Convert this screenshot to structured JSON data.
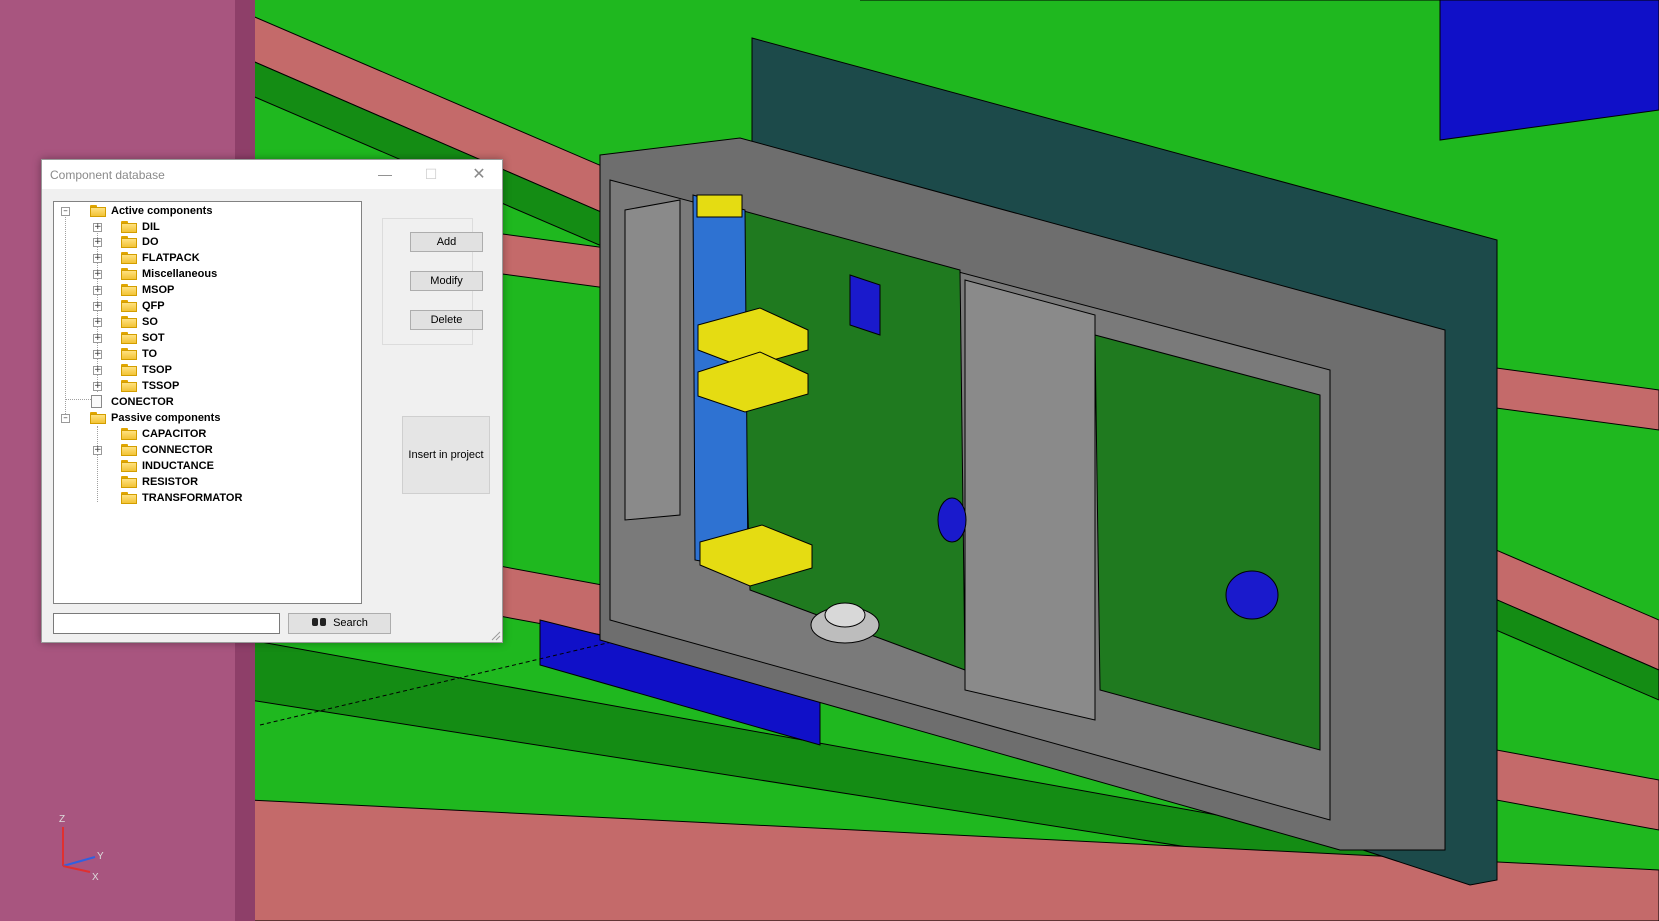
{
  "dialog": {
    "title": "Component database",
    "buttons": {
      "add": "Add",
      "modify": "Modify",
      "delete": "Delete",
      "insert": "Insert in project",
      "search": "Search"
    },
    "search_value": "",
    "tree": {
      "active": {
        "label": "Active components",
        "children": [
          "DIL",
          "DO",
          "FLATPACK",
          "Miscellaneous",
          "MSOP",
          "QFP",
          "SO",
          "SOT",
          "TO",
          "TSOP",
          "TSSOP"
        ]
      },
      "conector": "CONECTOR",
      "passive": {
        "label": "Passive components",
        "children": [
          "CAPACITOR",
          "CONNECTOR",
          "INDUCTANCE",
          "RESISTOR",
          "TRANSFORMATOR"
        ]
      }
    }
  },
  "axes_triad": {
    "z": "Z",
    "y": "Y",
    "x": "X"
  },
  "colors": {
    "green": "#1fb81f",
    "dark_green": "#148c14",
    "salmon": "#c46a6a",
    "blue": "#1010c8",
    "magenta": "#a8557f",
    "housing_gray": "#6e6e6e",
    "pcb_green": "#1f7a1f",
    "connector_yellow": "#e5dc12"
  }
}
